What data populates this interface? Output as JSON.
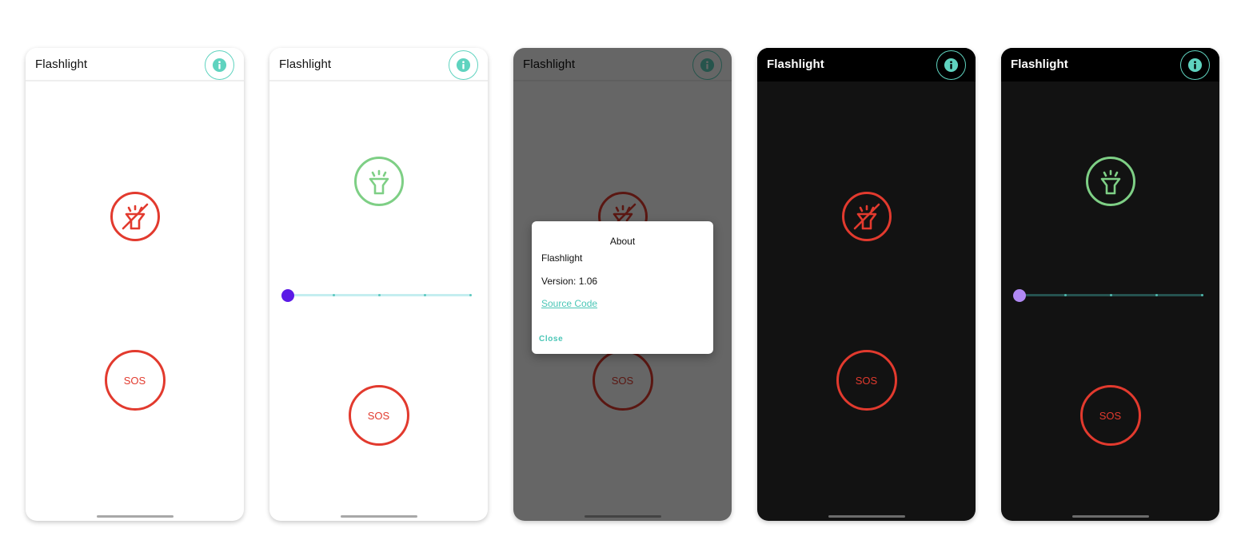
{
  "app_title": "Flashlight",
  "sos_label": "SOS",
  "colors": {
    "accent": "#5fd3bf",
    "torch_off": "#e23a2e",
    "torch_on": "#7ecf85",
    "slider_thumb_light": "#5b1ae6",
    "slider_thumb_dark": "#b089f3",
    "dark_background": "#121212"
  },
  "icons": {
    "info": "info-icon",
    "torch_off": "flashlight-off-icon",
    "torch_on": "flashlight-on-icon"
  },
  "screens": [
    {
      "theme": "light",
      "torch_state": "off",
      "slider_visible": false,
      "dialog_visible": false
    },
    {
      "theme": "light",
      "torch_state": "on",
      "slider_visible": true,
      "brightness_level": 0,
      "brightness_steps": 5,
      "dialog_visible": false
    },
    {
      "theme": "light",
      "torch_state": "off",
      "slider_visible": false,
      "dialog_visible": true
    },
    {
      "theme": "dark",
      "torch_state": "off",
      "slider_visible": false,
      "dialog_visible": false
    },
    {
      "theme": "dark",
      "torch_state": "on",
      "slider_visible": true,
      "brightness_level": 0,
      "brightness_steps": 5,
      "dialog_visible": false
    }
  ],
  "about_dialog": {
    "title": "About",
    "app_name": "Flashlight",
    "version": "Version: 1.06",
    "source_link": "Source Code",
    "close_label": "Close"
  }
}
